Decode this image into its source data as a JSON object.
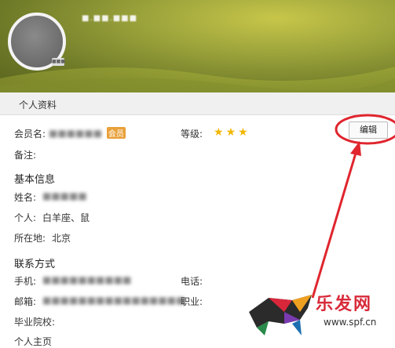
{
  "profile": {
    "nickname": "■.■■.■■■",
    "avatar_badge": "■■■"
  },
  "section": {
    "title": "个人资料"
  },
  "fields": {
    "member_label": "会员名:",
    "member_value": "■■■■■■",
    "vip_label": "会员",
    "level_label": "等级:",
    "level_stars": 3,
    "edit_label": "编辑",
    "note_label": "备注:",
    "basic_heading": "基本信息",
    "name_label": "姓名:",
    "name_value": "■■■■■",
    "personal_label": "个人:",
    "personal_value": "白羊座、鼠",
    "location_label": "所在地:",
    "location_value": "北京",
    "contact_heading": "联系方式",
    "phone_label": "手机:",
    "phone_value": "■■■■■■■■■■",
    "tel_label": "电话:",
    "email_label": "邮箱:",
    "email_value": "■■■■■■■■■■■■■■■■",
    "job_label": "职业:",
    "school_label": "毕业院校:",
    "homepage_label": "个人主页"
  },
  "watermark": {
    "text": "乐发网",
    "url": "www.spf.cn"
  },
  "colors": {
    "banner": "#9aa23a",
    "star": "#f2b700",
    "annotation": "#e0252e"
  }
}
